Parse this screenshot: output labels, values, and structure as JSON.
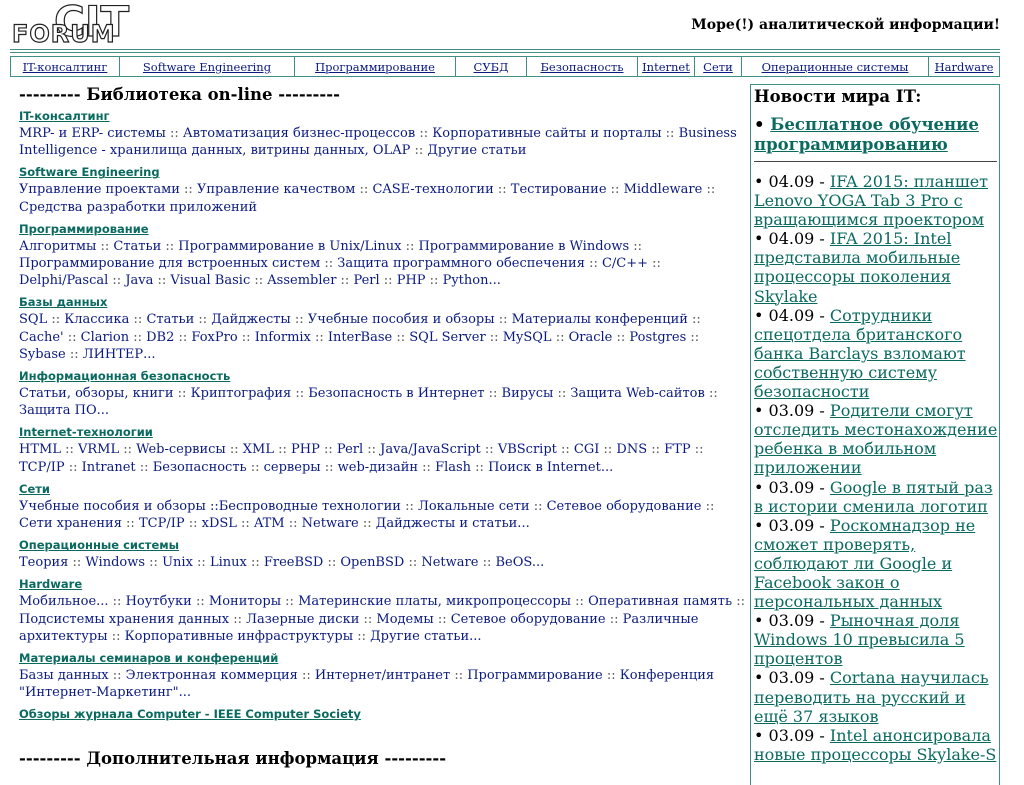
{
  "logo": {
    "text": "FORUM",
    "overlay": "CIT"
  },
  "tagline": "Море(!) аналитической информации!",
  "nav": [
    "IT-консалтинг",
    "Software Engineering",
    "Программирование",
    "СУБД",
    "Безопасность",
    "Internet",
    "Сети",
    "Операционные системы",
    "Hardware"
  ],
  "library_title": "--------- Библиотека on-line ---------",
  "sections": [
    {
      "title": "IT-консалтинг",
      "links": [
        "MRP- и ERP- системы",
        "Автоматизация бизнес-процессов",
        "Корпоративные сайты и порталы",
        "Business Intelligence - хранилища данных, витрины данных, OLAP",
        "Другие статьи"
      ]
    },
    {
      "title": "Software Engineering",
      "links": [
        "Управление проектами",
        "Управление качеством",
        "CASE-технологии",
        "Тестирование",
        "Middleware",
        "Средства разработки приложений"
      ]
    },
    {
      "title": "Программирование",
      "links": [
        "Алгоритмы",
        "Статьи",
        "Программирование в Unix/Linux",
        "Программирование в Windows",
        "Программирование для встроенных систем",
        "Защита программного обеспечения",
        "C/C++",
        "Delphi/Pascal",
        "Java",
        "Visual Basic",
        "Assembler",
        "Perl",
        "PHP",
        "Python..."
      ]
    },
    {
      "title": "Базы данных",
      "links": [
        "SQL",
        "Классика",
        "Статьи",
        "Дайджесты",
        "Учебные пособия и обзоры",
        "Материалы конференций",
        "Cache'",
        "Clarion",
        "DB2",
        "FoxPro",
        "Informix",
        "InterBase",
        "SQL Server",
        "MySQL",
        "Oracle",
        "Postgres",
        "Sybase",
        "ЛИНТЕР..."
      ]
    },
    {
      "title": "Информационная безопасность",
      "links": [
        "Статьи, обзоры, книги",
        "Криптография",
        "Безопасность в Интернет",
        "Вирусы",
        "Защита Web-сайтов",
        "Защита ПО..."
      ]
    },
    {
      "title": "Internet-технологии",
      "links": [
        "HTML",
        "VRML",
        "Web-сервисы",
        "XML",
        "PHP",
        "Perl",
        "Java/JavaScript",
        "VBScript",
        "CGI",
        "DNS",
        "FTP",
        "TCP/IP",
        "Intranet",
        "Безопасность",
        "серверы",
        "web-дизайн",
        "Flash",
        "Поиск в Internet..."
      ]
    },
    {
      "title": "Сети",
      "links": [
        "Учебные пособия и обзоры ::Беспроводные технологии",
        "Локальные сети",
        "Сетевое оборудование",
        "Сети хранения",
        "TCP/IP",
        "xDSL",
        "ATM",
        "Netware",
        "Дайджесты и статьи..."
      ]
    },
    {
      "title": "Операционные системы",
      "links": [
        "Теория",
        "Windows",
        "Unix",
        "Linux",
        "FreeBSD",
        "OpenBSD",
        "Netware",
        "BeOS..."
      ]
    },
    {
      "title": "Hardware",
      "links": [
        "Мобильное...",
        "Ноутбуки",
        "Мониторы",
        "Материнские платы, микропроцессоры",
        "Оперативная память",
        "Подсистемы хранения данных",
        "Лазерные диски",
        "Модемы",
        "Сетевое оборудование",
        "Различные архитектуры",
        "Корпоративные инфраструктуры",
        "Другие статьи..."
      ]
    },
    {
      "title": "Материалы семинаров и конференций",
      "links": [
        "Базы данных",
        "Электронная коммерция",
        "Интернет/интранет",
        "Программирование",
        "Конференция \"Интернет-Маркетинг\"..."
      ]
    },
    {
      "title": "Обзоры журнала Computer - IEEE Computer Society",
      "links": []
    }
  ],
  "extra_title": "--------- Дополнительная информация ---------",
  "news": {
    "title": "Новости мира IT:",
    "promo": "Бесплатное обучение программированию",
    "items": [
      {
        "date": "04.09",
        "text": "IFA 2015: планшет Lenovo YOGA Tab 3 Pro с вращающимся проектором"
      },
      {
        "date": "04.09",
        "text": "IFA 2015: Intel представила мобильные процессоры поколения Skylake"
      },
      {
        "date": "04.09",
        "text": "Сотрудники спецотдела британского банка Barclays взломают собственную систему безопасности"
      },
      {
        "date": "03.09",
        "text": "Родители смогут отследить местонахождение ребенка в мобильном приложении"
      },
      {
        "date": "03.09",
        "text": "Google в пятый раз в истории сменила логотип"
      },
      {
        "date": "03.09",
        "text": "Роскомнадзор не сможет проверять, соблюдают ли Google и Facebook закон о персональных данных"
      },
      {
        "date": "03.09",
        "text": "Рыночная доля Windows 10 превысила 5 процентов"
      },
      {
        "date": "03.09",
        "text": "Cortana научилась переводить на русский и ещё 37 языков"
      },
      {
        "date": "03.09",
        "text": "Intel анонсировала новые процессоры Skylake-S"
      }
    ]
  }
}
